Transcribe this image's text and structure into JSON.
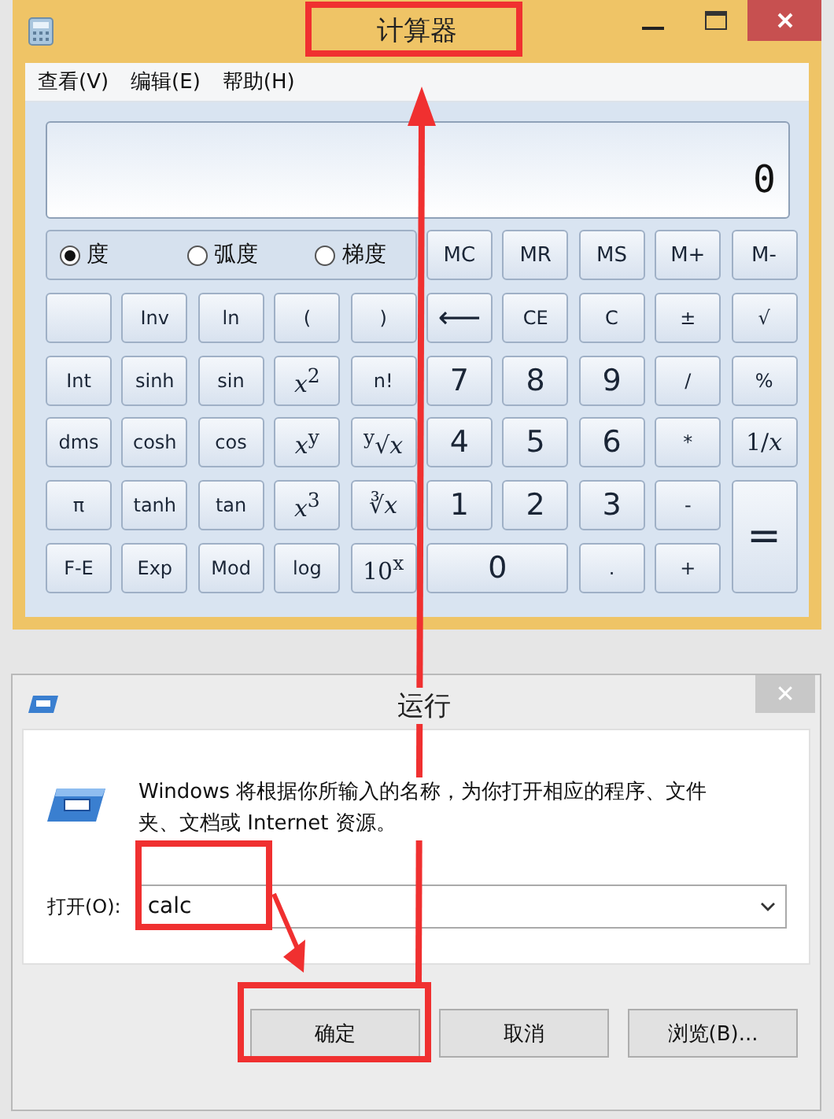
{
  "calculator": {
    "title": "计算器",
    "menu": [
      "查看(V)",
      "编辑(E)",
      "帮助(H)"
    ],
    "display": "0",
    "angle_modes": [
      {
        "label": "度",
        "selected": true
      },
      {
        "label": "弧度",
        "selected": false
      },
      {
        "label": "梯度",
        "selected": false
      }
    ],
    "keys": [
      {
        "kind": "modes"
      },
      {
        "kind": "memory",
        "label": "MC"
      },
      {
        "kind": "memory",
        "label": "MR"
      },
      {
        "kind": "memory",
        "label": "MS"
      },
      {
        "kind": "memory",
        "label": "M+"
      },
      {
        "kind": "memory",
        "label": "M-"
      },
      {
        "kind": "blank"
      },
      {
        "kind": "fn",
        "label": "Inv"
      },
      {
        "kind": "fn",
        "label": "ln"
      },
      {
        "kind": "fn",
        "label": "("
      },
      {
        "kind": "fn",
        "label": ")"
      },
      {
        "kind": "backspace",
        "label": "⟵"
      },
      {
        "kind": "fn",
        "label": "CE"
      },
      {
        "kind": "fn",
        "label": "C"
      },
      {
        "kind": "fn",
        "label": "±"
      },
      {
        "kind": "fn",
        "label": "√"
      },
      {
        "kind": "fn",
        "label": "Int"
      },
      {
        "kind": "fn",
        "label": "sinh"
      },
      {
        "kind": "fn",
        "label": "sin"
      },
      {
        "kind": "math",
        "label": "*x*$^{2}$"
      },
      {
        "kind": "fn",
        "label": "n!"
      },
      {
        "kind": "digit",
        "label": "7"
      },
      {
        "kind": "digit",
        "label": "8"
      },
      {
        "kind": "digit",
        "label": "9"
      },
      {
        "kind": "fn",
        "label": "/"
      },
      {
        "kind": "fn",
        "label": "%"
      },
      {
        "kind": "fn",
        "label": "dms"
      },
      {
        "kind": "fn",
        "label": "cosh"
      },
      {
        "kind": "fn",
        "label": "cos"
      },
      {
        "kind": "math",
        "label": "*x*$^{y}$"
      },
      {
        "kind": "math",
        "label": "$^{y}$√*x*"
      },
      {
        "kind": "digit",
        "label": "4"
      },
      {
        "kind": "digit",
        "label": "5"
      },
      {
        "kind": "digit",
        "label": "6"
      },
      {
        "kind": "fn",
        "label": "*"
      },
      {
        "kind": "math",
        "label": "1/*x*"
      },
      {
        "kind": "fn",
        "label": "π"
      },
      {
        "kind": "fn",
        "label": "tanh"
      },
      {
        "kind": "fn",
        "label": "tan"
      },
      {
        "kind": "math",
        "label": "*x*$^{3}$"
      },
      {
        "kind": "math",
        "label": "∛*x*"
      },
      {
        "kind": "digit",
        "label": "1"
      },
      {
        "kind": "digit",
        "label": "2"
      },
      {
        "kind": "digit",
        "label": "3"
      },
      {
        "kind": "fn",
        "label": "-"
      },
      {
        "kind": "equals",
        "label": "="
      },
      {
        "kind": "fn",
        "label": "F-E"
      },
      {
        "kind": "fn",
        "label": "Exp"
      },
      {
        "kind": "fn",
        "label": "Mod"
      },
      {
        "kind": "fn",
        "label": "log"
      },
      {
        "kind": "math",
        "label": "10$^{x}$"
      },
      {
        "kind": "zero",
        "label": "0"
      },
      {
        "kind": "fn",
        "label": "."
      },
      {
        "kind": "fn",
        "label": "+"
      }
    ]
  },
  "run_dialog": {
    "title": "运行",
    "close": "✕",
    "description": "Windows 将根据你所输入的名称，为你打开相应的程序、文件夹、文档或 Internet 资源。",
    "open_label": "打开(O):",
    "open_value": "calc",
    "buttons": [
      "确定",
      "取消",
      "浏览(B)..."
    ]
  }
}
